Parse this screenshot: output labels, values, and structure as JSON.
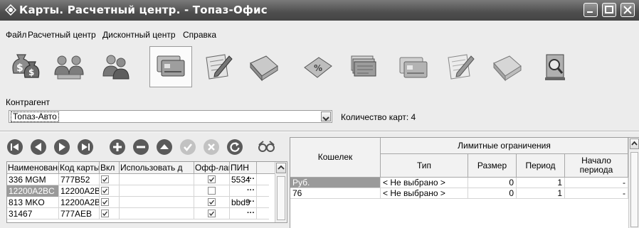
{
  "window": {
    "title": "Карты. Расчетный центр. - Топаз-Офис"
  },
  "menu": [
    "Файл",
    "Расчетный центр",
    "Дисконтный центр",
    "Справка"
  ],
  "toolbar": [
    {
      "icon": "money-bag-icon",
      "active": false
    },
    {
      "icon": "users-group-icon",
      "active": false
    },
    {
      "icon": "users-pair-icon",
      "active": false
    },
    {
      "icon": "cards-icon",
      "active": true
    },
    {
      "icon": "edit-document-icon",
      "active": false
    },
    {
      "icon": "folder-icon",
      "active": false
    },
    {
      "icon": "discount-card-icon",
      "active": false
    },
    {
      "icon": "card-stack-icon",
      "active": false
    },
    {
      "icon": "cards-icon",
      "active": false
    },
    {
      "icon": "edit-document-icon",
      "active": false
    },
    {
      "icon": "folder-icon",
      "active": false
    },
    {
      "icon": "report-search-icon",
      "active": false
    }
  ],
  "contractor": {
    "label": "Контрагент",
    "value": "Топаз-Авто",
    "count_text": "Количество карт: 4"
  },
  "navigator": [
    "first-icon",
    "prev-icon",
    "next-icon",
    "last-icon",
    "add-icon",
    "delete-icon",
    "edit-icon",
    "post-icon",
    "cancel-icon",
    "refresh-icon",
    "link-icon"
  ],
  "cards": {
    "columns": [
      "Наименовани",
      "Код карты",
      "Вкл",
      "Использовать д",
      "Офф-лайн",
      "ПИН"
    ],
    "rows": [
      {
        "name": "336 MGM",
        "code": "777B52",
        "enabled": true,
        "use": "",
        "offline": true,
        "pin": "5534"
      },
      {
        "name": "12200A2BC",
        "code": "12200A2B",
        "enabled": true,
        "use": "",
        "offline": false,
        "pin": ""
      },
      {
        "name": "813 MKO",
        "code": "12200A2B",
        "enabled": true,
        "use": "",
        "offline": true,
        "pin": "bbd9"
      },
      {
        "name": "31467",
        "code": "777AEB",
        "enabled": true,
        "use": "",
        "offline": true,
        "pin": ""
      }
    ]
  },
  "limits": {
    "wallet_header": "Кошелек",
    "group_header": "Лимитные ограничения",
    "sub_headers": [
      "Тип",
      "Размер",
      "Период",
      "Начало периода"
    ],
    "rows": [
      {
        "wallet": "Руб.",
        "type": "< Не выбрано >",
        "size": "0",
        "period": "1",
        "start": "-"
      },
      {
        "wallet": "76",
        "type": "< Не выбрано >",
        "size": "0",
        "period": "1",
        "start": "-"
      }
    ]
  },
  "colors": {
    "titlebar": "#505050",
    "selection": "#9a9a9a",
    "nav_button": "#5a5a5a"
  }
}
